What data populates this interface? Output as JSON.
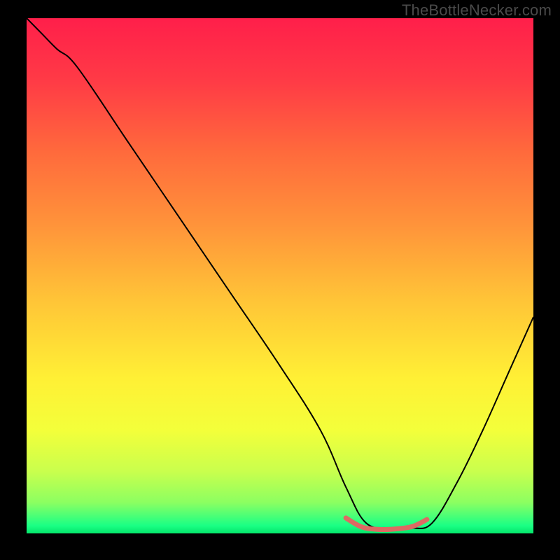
{
  "watermark": "TheBottleNecker.com",
  "chart_data": {
    "type": "line",
    "title": "",
    "xlabel": "",
    "ylabel": "",
    "xlim": [
      0,
      100
    ],
    "ylim": [
      0,
      100
    ],
    "grid": false,
    "annotations": [],
    "series": [
      {
        "name": "curve",
        "color": "#000000",
        "x": [
          0,
          3,
          6,
          10,
          20,
          30,
          40,
          50,
          58,
          63,
          67,
          72,
          76,
          80,
          85,
          90,
          95,
          100
        ],
        "y": [
          100,
          97,
          94,
          90.5,
          76,
          61.5,
          47,
          32.5,
          20,
          9,
          2,
          1,
          1,
          2,
          10,
          20,
          31,
          42
        ]
      },
      {
        "name": "highlight",
        "color": "#dd6a63",
        "x": [
          63,
          66,
          69,
          72,
          76,
          79
        ],
        "y": [
          3,
          1.3,
          0.8,
          0.8,
          1.3,
          2.7
        ]
      }
    ],
    "gradient_stops": [
      {
        "offset": 0.0,
        "color": "#ff1f4a"
      },
      {
        "offset": 0.12,
        "color": "#ff3a46"
      },
      {
        "offset": 0.26,
        "color": "#ff6a3c"
      },
      {
        "offset": 0.4,
        "color": "#ff933a"
      },
      {
        "offset": 0.55,
        "color": "#ffc537"
      },
      {
        "offset": 0.7,
        "color": "#fff035"
      },
      {
        "offset": 0.8,
        "color": "#f3ff3a"
      },
      {
        "offset": 0.88,
        "color": "#c9ff4d"
      },
      {
        "offset": 0.94,
        "color": "#8cff61"
      },
      {
        "offset": 0.965,
        "color": "#4dff76"
      },
      {
        "offset": 0.985,
        "color": "#1aff84"
      },
      {
        "offset": 1.0,
        "color": "#04e66b"
      }
    ]
  }
}
